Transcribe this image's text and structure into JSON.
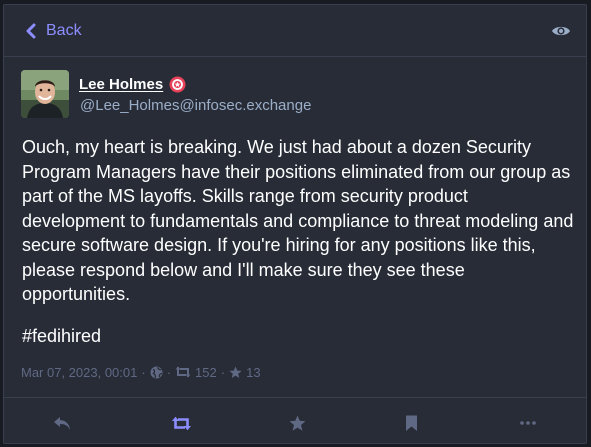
{
  "header": {
    "back_label": "Back"
  },
  "post": {
    "author": {
      "display_name": "Lee Holmes",
      "handle": "@Lee_Holmes@infosec.exchange",
      "badge_icon": "verified-badge-icon"
    },
    "content": "Ouch, my heart is breaking. We just had about a dozen Security Program Managers have their positions eliminated from our group as part of the MS layoffs. Skills range from security product development to fundamentals and compliance to threat modeling and secure software design. If you're hiring for any positions like this, please respond below and I'll make sure they see these opportunities.",
    "hashtag": "#fedihired",
    "meta": {
      "timestamp": "Mar 07, 2023, 00:01",
      "separator": "·",
      "visibility_icon": "globe-icon",
      "boosts": "152",
      "favourites": "13"
    }
  },
  "actions": [
    {
      "name": "reply",
      "icon": "reply-icon"
    },
    {
      "name": "boost",
      "icon": "boost-icon"
    },
    {
      "name": "favourite",
      "icon": "star-icon"
    },
    {
      "name": "bookmark",
      "icon": "bookmark-icon"
    },
    {
      "name": "more",
      "icon": "ellipsis-icon"
    }
  ],
  "colors": {
    "background": "#191b22",
    "card": "#282c37",
    "accent": "#8c8dff",
    "muted": "#606984",
    "handle": "#9baec8",
    "text": "#ffffff",
    "badge": "#e8425a"
  }
}
